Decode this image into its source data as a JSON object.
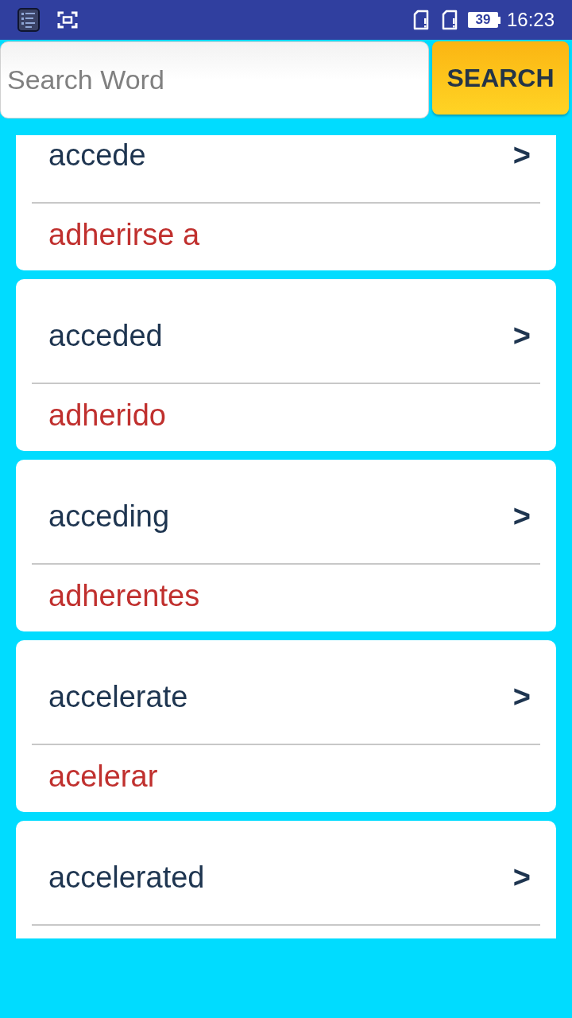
{
  "status_bar": {
    "battery": "39",
    "time": "16:23"
  },
  "search": {
    "placeholder": "Search Word",
    "button": "SEARCH"
  },
  "entries": [
    {
      "word": "accede",
      "arrow": ">",
      "translation": "adherirse a"
    },
    {
      "word": "acceded",
      "arrow": ">",
      "translation": "adherido"
    },
    {
      "word": "acceding",
      "arrow": ">",
      "translation": "adherentes"
    },
    {
      "word": "accelerate",
      "arrow": ">",
      "translation": "acelerar"
    },
    {
      "word": "accelerated",
      "arrow": ">"
    }
  ]
}
